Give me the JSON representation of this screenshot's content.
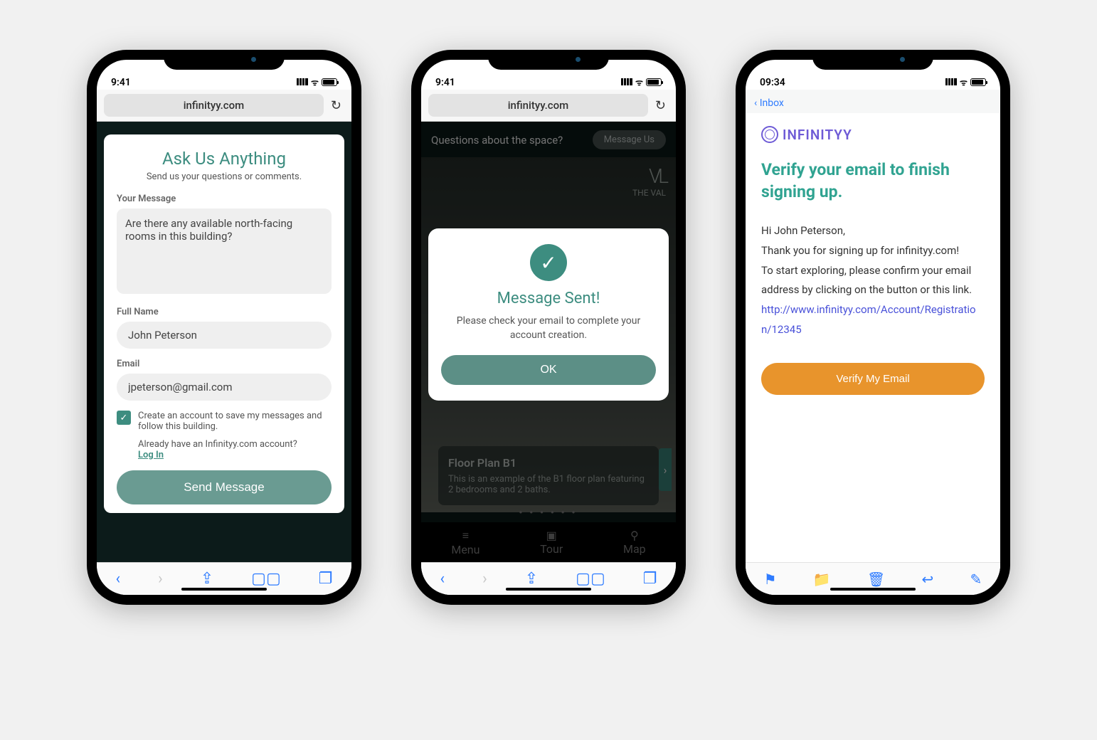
{
  "status_time_a": "9:41",
  "status_time_b": "9:41",
  "status_time_c": "09:34",
  "safari_url": "infinityy.com",
  "phone1": {
    "title": "Ask Us Anything",
    "subtitle": "Send us your questions or comments.",
    "msg_label": "Your Message",
    "msg_value": "Are there any available north-facing rooms in this building?",
    "name_label": "Full Name",
    "name_value": "John Peterson",
    "email_label": "Email",
    "email_value": "jpeterson@gmail.com",
    "chk_text": "Create an account to save my messages and follow this building.",
    "login_prompt": "Already have an Infinityy.com account?",
    "login_link": "Log In",
    "send_label": "Send Message"
  },
  "phone2": {
    "header_q": "Questions about the space?",
    "msg_us": "Message Us",
    "vl_brand": "THE VAL",
    "modal_title": "Message Sent!",
    "modal_body": "Please check your email to complete your account creation.",
    "ok_label": "OK",
    "floor_title": "Floor Plan B1",
    "floor_desc": "This is an example of the B1 floor plan featuring 2 bedrooms and 2 baths.",
    "nav_menu": "Menu",
    "nav_tour": "Tour",
    "nav_map": "Map"
  },
  "phone3": {
    "back": "Inbox",
    "logo_text": "INFINITYY",
    "heading": "Verify your email to finish signing up.",
    "greeting": "Hi John Peterson,",
    "line1": "Thank you for signing up for infinityy.com!",
    "line2": "To start exploring, please confirm your email address by clicking on the button or this link.",
    "link": "http://www.infinityy.com/Account/Registration/12345",
    "verify_label": "Verify My Email"
  }
}
